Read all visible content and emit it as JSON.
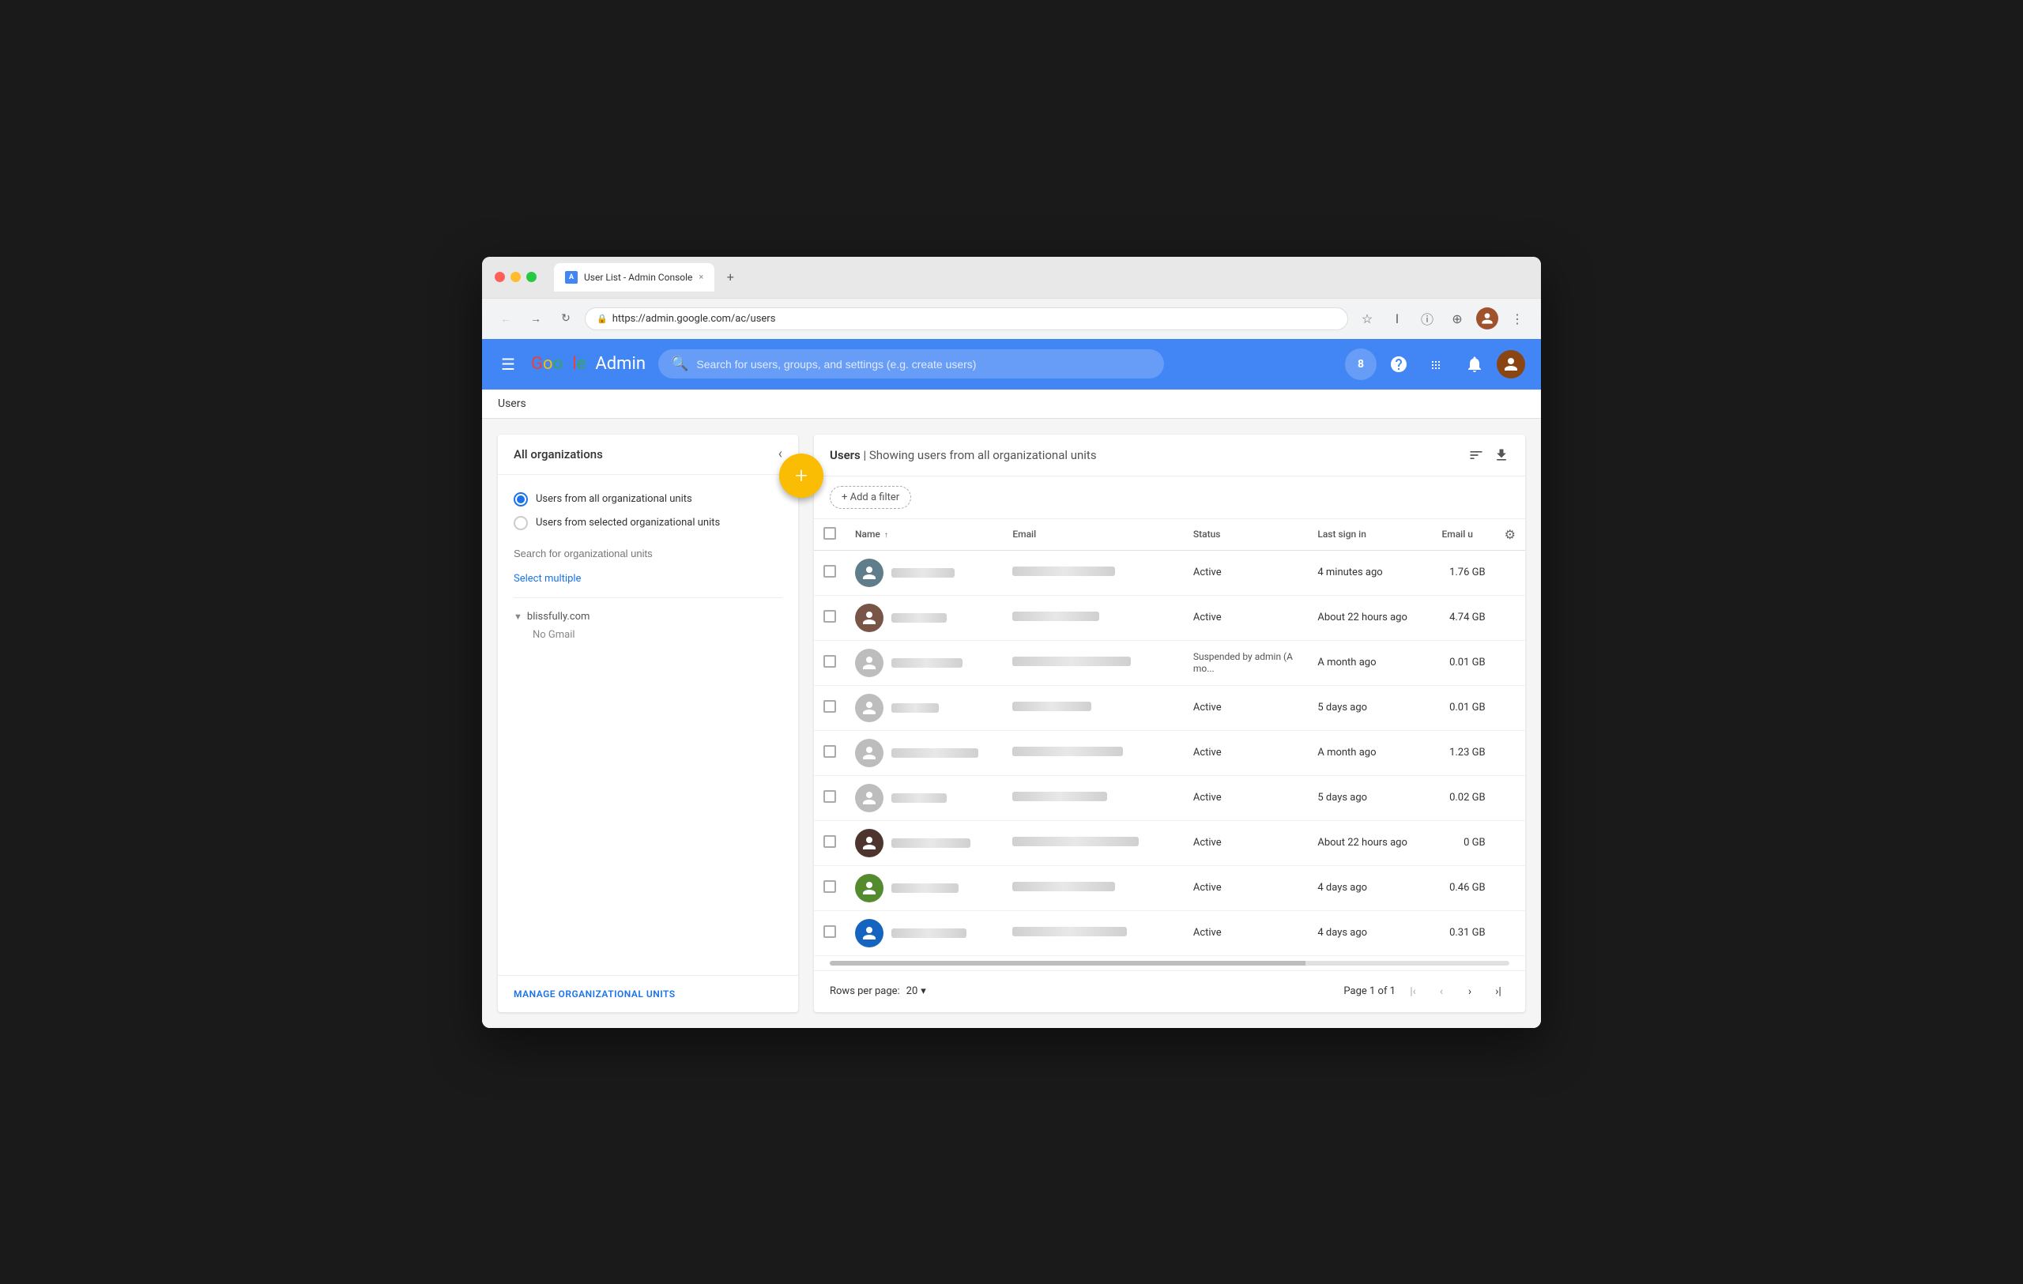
{
  "titlebar": {
    "tab_title": "User List - Admin Console",
    "close_symbol": "×",
    "new_tab_symbol": "+"
  },
  "addressbar": {
    "url": "https://admin.google.com/ac/users",
    "back_symbol": "←",
    "forward_symbol": "→",
    "refresh_symbol": "↻"
  },
  "header": {
    "menu_symbol": "☰",
    "google_text": "Google",
    "admin_text": "Admin",
    "search_placeholder": "Search for users, groups, and settings (e.g. create users)",
    "support_number": "8",
    "help_symbol": "?",
    "apps_symbol": "⠿",
    "bell_symbol": "🔔"
  },
  "breadcrumb": {
    "text": "Users"
  },
  "sidebar": {
    "title": "All organizations",
    "collapse_symbol": "‹",
    "options": [
      {
        "label": "Users from all organizational units",
        "selected": true
      },
      {
        "label": "Users from selected organizational units",
        "selected": false
      }
    ],
    "search_placeholder": "Search for organizational units",
    "select_multiple": "Select multiple",
    "org_name": "blissfully.com",
    "org_sub": "No Gmail",
    "manage_btn": "MANAGE ORGANIZATIONAL UNITS"
  },
  "fab": {
    "symbol": "+"
  },
  "panel": {
    "title_bold": "Users",
    "title_rest": " | Showing users from all organizational units",
    "add_filter_label": "+ Add a filter",
    "columns": [
      {
        "key": "name",
        "label": "Name",
        "sortable": true
      },
      {
        "key": "email",
        "label": "Email"
      },
      {
        "key": "status",
        "label": "Status"
      },
      {
        "key": "last_sign_in",
        "label": "Last sign in"
      },
      {
        "key": "email_usage",
        "label": "Email u"
      }
    ],
    "users": [
      {
        "id": 1,
        "has_photo": true,
        "photo_bg": "#607d8b",
        "name_blurred": true,
        "email_blurred": true,
        "status": "Active",
        "last_sign_in": "4 minutes ago",
        "email_usage": "1.76 GB"
      },
      {
        "id": 2,
        "has_photo": true,
        "photo_bg": "#795548",
        "name_blurred": true,
        "email_blurred": true,
        "status": "Active",
        "last_sign_in": "About 22 hours ago",
        "email_usage": "4.74 GB"
      },
      {
        "id": 3,
        "has_photo": false,
        "photo_bg": "#bdbdbd",
        "name_blurred": true,
        "email_blurred": true,
        "status": "Suspended by admin (A mo...",
        "last_sign_in": "A month ago",
        "email_usage": "0.01 GB"
      },
      {
        "id": 4,
        "has_photo": false,
        "photo_bg": "#bdbdbd",
        "name_blurred": true,
        "email_blurred": true,
        "status": "Active",
        "last_sign_in": "5 days ago",
        "email_usage": "0.01 GB"
      },
      {
        "id": 5,
        "has_photo": false,
        "photo_bg": "#bdbdbd",
        "name_blurred": true,
        "email_blurred": true,
        "status": "Active",
        "last_sign_in": "A month ago",
        "email_usage": "1.23 GB"
      },
      {
        "id": 6,
        "has_photo": false,
        "photo_bg": "#bdbdbd",
        "name_blurred": true,
        "email_blurred": true,
        "status": "Active",
        "last_sign_in": "5 days ago",
        "email_usage": "0.02 GB"
      },
      {
        "id": 7,
        "has_photo": true,
        "photo_bg": "#4e342e",
        "name_blurred": true,
        "email_blurred": true,
        "status": "Active",
        "last_sign_in": "About 22 hours ago",
        "email_usage": "0 GB"
      },
      {
        "id": 8,
        "has_photo": true,
        "photo_bg": "#558b2f",
        "name_blurred": true,
        "email_blurred": true,
        "status": "Active",
        "last_sign_in": "4 days ago",
        "email_usage": "0.46 GB"
      },
      {
        "id": 9,
        "has_photo": true,
        "photo_bg": "#1565c0",
        "name_blurred": true,
        "email_blurred": true,
        "status": "Active",
        "last_sign_in": "4 days ago",
        "email_usage": "0.31 GB"
      }
    ],
    "pagination": {
      "rows_per_page_label": "Rows per page:",
      "rows_per_page_value": "20",
      "page_info": "Page 1 of 1",
      "first_symbol": "|‹",
      "prev_symbol": "‹",
      "next_symbol": "›",
      "last_symbol": "›|"
    }
  }
}
